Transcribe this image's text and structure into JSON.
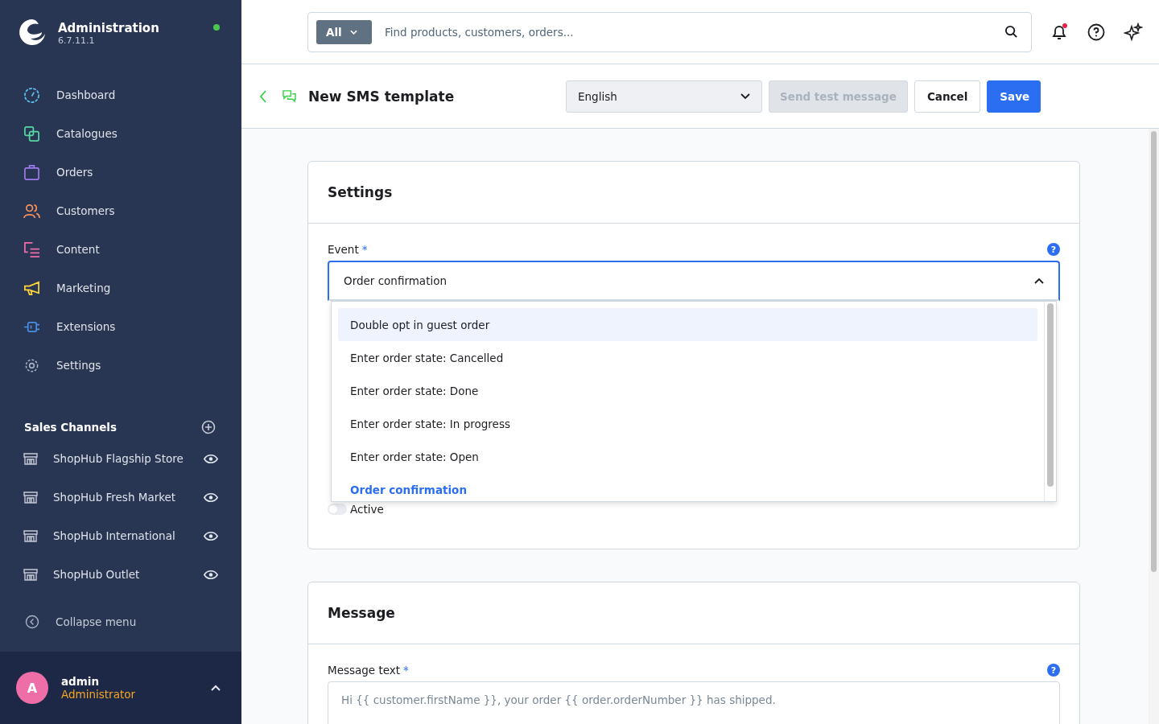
{
  "app": {
    "title": "Administration",
    "version": "6.7.11.1",
    "online": true
  },
  "nav": [
    {
      "label": "Dashboard",
      "kind": "dashboard"
    },
    {
      "label": "Catalogues",
      "kind": "catalogues"
    },
    {
      "label": "Orders",
      "kind": "orders"
    },
    {
      "label": "Customers",
      "kind": "customers"
    },
    {
      "label": "Content",
      "kind": "content"
    },
    {
      "label": "Marketing",
      "kind": "marketing"
    },
    {
      "label": "Extensions",
      "kind": "extensions"
    },
    {
      "label": "Settings",
      "kind": "settings"
    }
  ],
  "sales_channels": {
    "title": "Sales Channels",
    "items": [
      {
        "label": "ShopHub Flagship Store"
      },
      {
        "label": "ShopHub Fresh Market"
      },
      {
        "label": "ShopHub International"
      },
      {
        "label": "ShopHub Outlet"
      }
    ]
  },
  "collapse_menu": "Collapse menu",
  "user": {
    "initial": "A",
    "name": "admin",
    "role": "Administrator"
  },
  "search": {
    "scope": "All",
    "placeholder": "Find products, customers, orders..."
  },
  "notifications": {
    "unread": true
  },
  "header": {
    "title": "New SMS template",
    "language": "English",
    "send_test": {
      "label": "Send test message",
      "disabled": true
    },
    "cancel": "Cancel",
    "save": "Save"
  },
  "settings_card": {
    "title": "Settings",
    "event_label": "Event",
    "required_mark": "*",
    "help": "?",
    "event_value": "Order confirmation",
    "expanded": true,
    "options": [
      {
        "label": "Double opt in guest order",
        "highlighted": true,
        "selected": false
      },
      {
        "label": "Enter order state: Cancelled",
        "highlighted": false,
        "selected": false
      },
      {
        "label": "Enter order state: Done",
        "highlighted": false,
        "selected": false
      },
      {
        "label": "Enter order state: In progress",
        "highlighted": false,
        "selected": false
      },
      {
        "label": "Enter order state: Open",
        "highlighted": false,
        "selected": false
      },
      {
        "label": "Order confirmation",
        "highlighted": false,
        "selected": true
      }
    ],
    "active": {
      "label": "Active",
      "on": false
    }
  },
  "message_card": {
    "title": "Message",
    "label": "Message text",
    "required_mark": "*",
    "help": "?",
    "placeholder": "Hi {{ customer.firstName }}, your order {{ order.orderNumber }} has shipped."
  }
}
